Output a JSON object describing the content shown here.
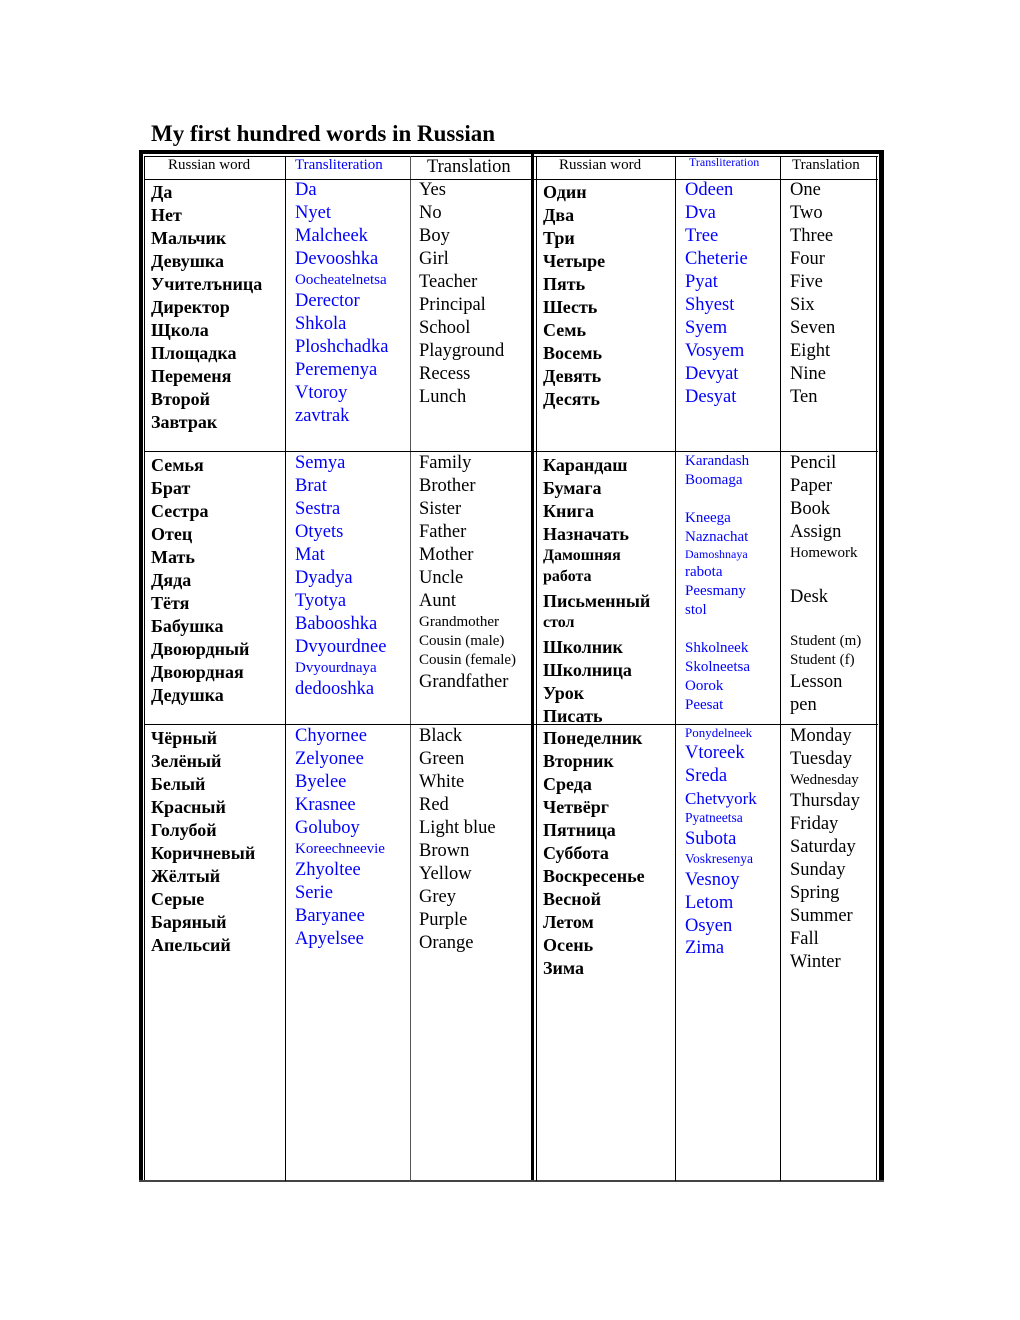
{
  "title": "My first hundred words in Russian",
  "colors": {
    "transliteration": "#0000ff",
    "text": "#000000"
  },
  "headers": {
    "left": [
      "Russian word",
      "Transliteration",
      "Translation"
    ],
    "right": [
      "Russian word",
      "Transliteration",
      "Translation"
    ]
  },
  "sections": [
    {
      "left": {
        "russian": [
          "Да",
          "Нет",
          "Мальчик",
          "Девушка",
          "Учителъница",
          "Директор",
          "Щкола",
          "Площадка",
          "Переменя",
          "Второй",
          "Завтрак"
        ],
        "transliteration": [
          "Da",
          "Nyet",
          "Malcheek",
          "Devooshka",
          "Oocheatelnetsa",
          "Derector",
          "Shkola",
          "Ploshchadka",
          "Peremenya",
          "Vtoroy",
          "zavtrak"
        ],
        "translation": [
          "Yes",
          "No",
          "Boy",
          "Girl",
          "Teacher",
          "Principal",
          "School",
          "Playground",
          "Recess",
          "Lunch"
        ]
      },
      "right": {
        "russian": [
          "Один",
          "Два",
          "Три",
          "Четыре",
          "Пять",
          "Шесть",
          "Семь",
          "Восемь",
          "Девять",
          "Десять"
        ],
        "transliteration": [
          "Odeen",
          "Dva",
          "Tree",
          "Cheterie",
          "Pyat",
          "Shyest",
          "Syem",
          "Vosyem",
          "Devyat",
          "Desyat"
        ],
        "translation": [
          "One",
          "Two",
          "Three",
          "Four",
          "Five",
          "Six",
          "Seven",
          "Eight",
          "Nine",
          "Ten"
        ]
      }
    },
    {
      "left": {
        "russian": [
          "Семья",
          "Брат",
          "Сестра",
          "Отец",
          "Мать",
          "Дяда",
          "Тётя",
          "Бабушка",
          "Двоюрдный",
          "Двоюрдная",
          "Дедушка"
        ],
        "transliteration": [
          "Semya",
          "Brat",
          "Sestra",
          "Otyets",
          "Mat",
          "Dyadya",
          "Tyotya",
          "Babooshka",
          "Dvyourdnee",
          "Dvyourdnaya",
          "dedooshka"
        ],
        "translation": [
          "Family",
          "Brother",
          "Sister",
          "Father",
          "Mother",
          "Uncle",
          "Aunt",
          "Grandmother",
          "Cousin (male)",
          "Cousin (female)",
          "Grandfather"
        ]
      },
      "right": {
        "russian": [
          "Карандаш",
          "Бумага",
          "Книга",
          "Назначать",
          "Дамошняя",
          "работа",
          "Письменный",
          "стол",
          "Школник",
          "Школница",
          "Урок",
          "Писать"
        ],
        "transliteration": [
          "Karandash",
          "Boomaga",
          "Kneega",
          "Naznachat",
          "Damoshnaya",
          "rabota",
          "Peesmany",
          "stol",
          "Shkolneek",
          "Skolneetsa",
          "Oorok",
          "Peesat"
        ],
        "translation": [
          "Pencil",
          "Paper",
          "Book",
          "Assign",
          "Homework",
          "Desk",
          "Student (m)",
          "Student (f)",
          "Lesson",
          "pen"
        ]
      }
    },
    {
      "left": {
        "russian": [
          "Чёрный",
          "Зелёный",
          "Белый",
          "Красный",
          "Голубой",
          "Коричневый",
          "Жёлтый",
          "Серые",
          "Баряный",
          "Апельсий"
        ],
        "transliteration": [
          "Chyornee",
          "Zelyonee",
          "Byelee",
          "Krasnee",
          "Goluboy",
          "Koreechneevie",
          "Zhyoltee",
          "Serie",
          "Baryanee",
          "Apyelsee"
        ],
        "translation": [
          "Black",
          "Green",
          "White",
          "Red",
          "Light blue",
          "Brown",
          "Yellow",
          "Grey",
          "Purple",
          "Orange"
        ]
      },
      "right": {
        "russian": [
          "Понеделник",
          "Вторник",
          "Среда",
          "Четвёрг",
          "Пятница",
          "Суббота",
          "Воскресенье",
          "Весной",
          "Летом",
          "Осень",
          "Зима"
        ],
        "transliteration": [
          "Ponydelneek",
          "Vtoreek",
          "Sreda",
          "Chetvyork",
          "Pyatneetsa",
          "Subota",
          "Voskresenya",
          "Vesnoy",
          "Letom",
          "Osyen",
          "Zima"
        ],
        "translation": [
          "Monday",
          "Tuesday",
          "Wednesday",
          "Thursday",
          "Friday",
          "Saturday",
          "Sunday",
          "Spring",
          "Summer",
          "Fall",
          "Winter"
        ]
      }
    }
  ]
}
